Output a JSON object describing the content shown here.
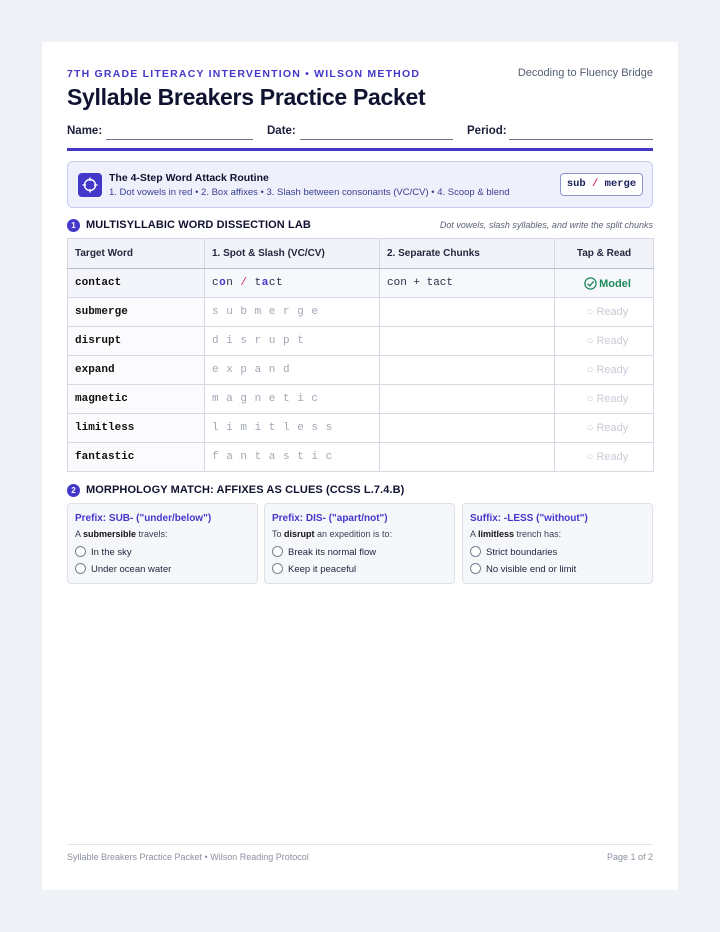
{
  "header": {
    "kicker": "7TH GRADE LITERACY INTERVENTION • WILSON METHOD",
    "bridge": "Decoding to Fluency Bridge",
    "title": "Syllable Breakers Practice Packet"
  },
  "fields": {
    "name": "Name:",
    "date": "Date:",
    "period": "Period:"
  },
  "routine": {
    "icon": "target-icon",
    "title": "The 4-Step Word Attack Routine",
    "steps": "1. Dot vowels in red • 2. Box affixes • 3. Slash between consonants (VC/CV) • 4. Scoop & blend",
    "chip_left": "sub",
    "chip_slash": "/",
    "chip_right": "merge"
  },
  "section1": {
    "number": "1",
    "title": "MULTISYLLABIC WORD DISSECTION LAB",
    "note": "Dot vowels, slash syllables, and write the split chunks",
    "columns": [
      "Target Word",
      "1. Spot & Slash (VC/CV)",
      "2. Separate Chunks",
      "Tap & Read"
    ],
    "model": {
      "word": "contact",
      "spot_parts": [
        "c",
        "o",
        "n ",
        "/",
        " t",
        "a",
        "ct"
      ],
      "chunks": "con + tact",
      "tap": "Model"
    },
    "rows": [
      {
        "word": "submerge",
        "spot": "s u b m e r g e",
        "tap": "○ Ready"
      },
      {
        "word": "disrupt",
        "spot": "d i s r u p t",
        "tap": "○ Ready"
      },
      {
        "word": "expand",
        "spot": "e x p a n d",
        "tap": "○ Ready"
      },
      {
        "word": "magnetic",
        "spot": "m a g n e t i c",
        "tap": "○ Ready"
      },
      {
        "word": "limitless",
        "spot": "l i m i t l e s s",
        "tap": "○ Ready"
      },
      {
        "word": "fantastic",
        "spot": "f a n t a s t i c",
        "tap": "○ Ready"
      }
    ]
  },
  "section2": {
    "number": "2",
    "title": "MORPHOLOGY MATCH: AFFIXES AS CLUES (CCSS L.7.4.B)",
    "cards": [
      {
        "title": "Prefix: SUB- (\"under/below\")",
        "pre": "A ",
        "bold": "submersible",
        "post": " travels:",
        "options": [
          "In the sky",
          "Under ocean water"
        ]
      },
      {
        "title": "Prefix: DIS- (\"apart/not\")",
        "pre": "To ",
        "bold": "disrupt",
        "post": " an expedition is to:",
        "options": [
          "Break its normal flow",
          "Keep it peaceful"
        ]
      },
      {
        "title": "Suffix: -LESS (\"without\")",
        "pre": "A ",
        "bold": "limitless",
        "post": " trench has:",
        "options": [
          "Strict boundaries",
          "No visible end or limit"
        ]
      }
    ]
  },
  "footer": {
    "left": "Syllable Breakers Practice Packet • Wilson Reading Protocol",
    "right": "Page 1 of 2"
  },
  "colors": {
    "accent": "#4338ca",
    "slash": "#d2335c",
    "model_green": "#1f8a5a"
  }
}
